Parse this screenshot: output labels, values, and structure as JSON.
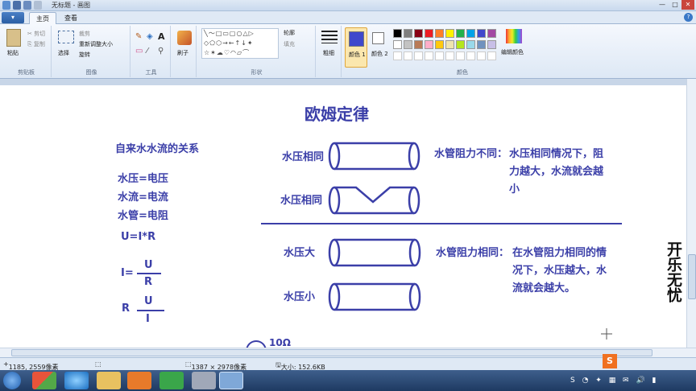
{
  "window": {
    "title": "无标题 - 画图"
  },
  "tabs": [
    "主页",
    "查看"
  ],
  "ribbon": {
    "clipboard": {
      "paste": "粘贴",
      "cut": "剪切",
      "copy": "复制",
      "label": "剪贴板"
    },
    "image": {
      "select": "选择",
      "crop": "裁剪",
      "resize": "重新调整大小",
      "rotate": "旋转",
      "label": "图像"
    },
    "tools": {
      "label": "工具"
    },
    "brushes": {
      "label": "刷子"
    },
    "shapes": {
      "outline": "轮廓",
      "fill": "填充",
      "label": "形状"
    },
    "size": {
      "label": "粗细"
    },
    "color1": {
      "label": "颜色 1"
    },
    "color2": {
      "label": "颜色 2"
    },
    "colors": {
      "label": "颜色",
      "edit": "编辑颜色"
    },
    "palette": [
      "#000000",
      "#7f7f7f",
      "#880015",
      "#ed1c24",
      "#ff7f27",
      "#fff200",
      "#22b14c",
      "#00a2e8",
      "#3f48cc",
      "#a349a4",
      "#ffffff",
      "#c3c3c3",
      "#b97a57",
      "#ffaec9",
      "#ffc90e",
      "#efe4b0",
      "#b5e61d",
      "#99d9ea",
      "#7092be",
      "#c8bfe7"
    ],
    "color1_value": "#3f48cc",
    "color2_value": "#ffffff"
  },
  "canvas": {
    "title": "欧姆定律",
    "relation_heading": "自来水水流的关系",
    "mapping": [
      "水压=电压",
      "水流=电流",
      "水管=电阻"
    ],
    "formula1": "U=I*R",
    "formula2": {
      "lhs": "I=",
      "num": "U",
      "den": "R"
    },
    "formula3": {
      "lhs": "R",
      "num": "U",
      "den": "I"
    },
    "pipe_labels": [
      "水压相同",
      "水压相同",
      "水压大",
      "水压小"
    ],
    "note1": {
      "label": "水管阻力不同：",
      "lines": [
        "水压相同情况下，阻",
        "力越大，水流就会越",
        "小"
      ]
    },
    "note2": {
      "label": "水管阻力相同：",
      "lines": [
        "在水管阻力相同的情",
        "况下，水压越大，水",
        "流就会越大。"
      ]
    },
    "resistor_value": "10Ω",
    "watermark": "开乐无忧"
  },
  "status": {
    "cursor": "1185, 2559像素",
    "dimensions": "1387 × 2978像素",
    "size": "大小: 152.6KB"
  }
}
